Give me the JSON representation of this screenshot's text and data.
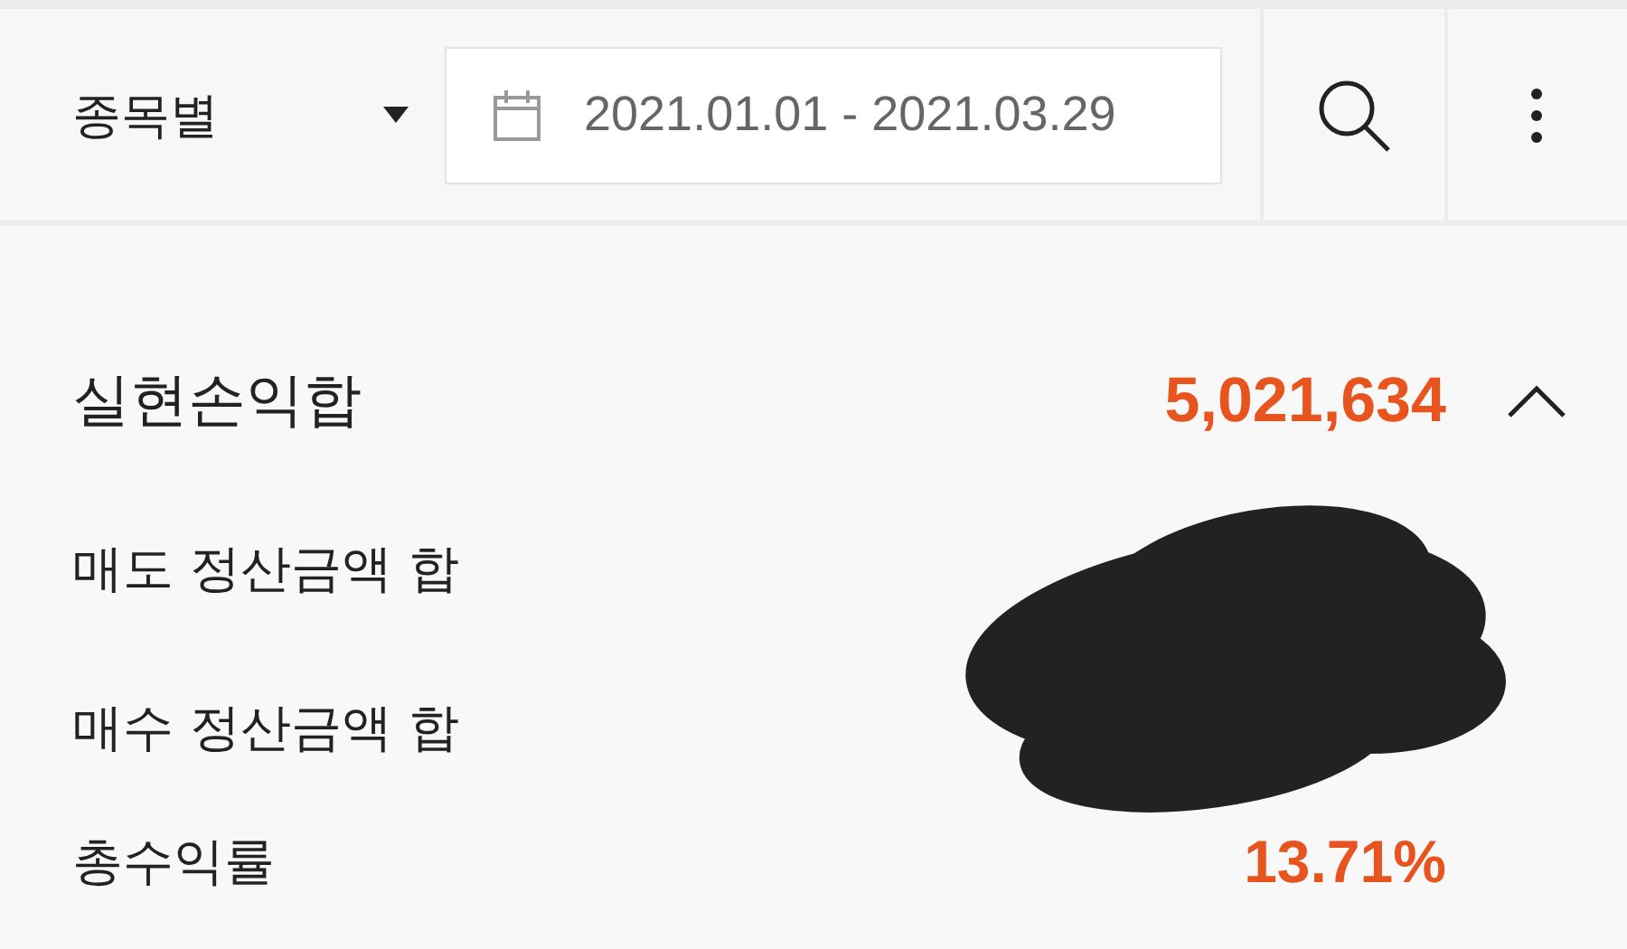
{
  "toolbar": {
    "filter": "종목별",
    "date_range": "2021.01.01 - 2021.03.29"
  },
  "summary": {
    "label": "실현손익합",
    "value": "5,021,634",
    "expanded": true
  },
  "rows": [
    {
      "label": "매도 정산금액 합",
      "kind": "hidden"
    },
    {
      "label": "매수 정산금액 합",
      "kind": "hidden"
    },
    {
      "label": "총수익률",
      "kind": "value",
      "value": "13.71%"
    }
  ]
}
